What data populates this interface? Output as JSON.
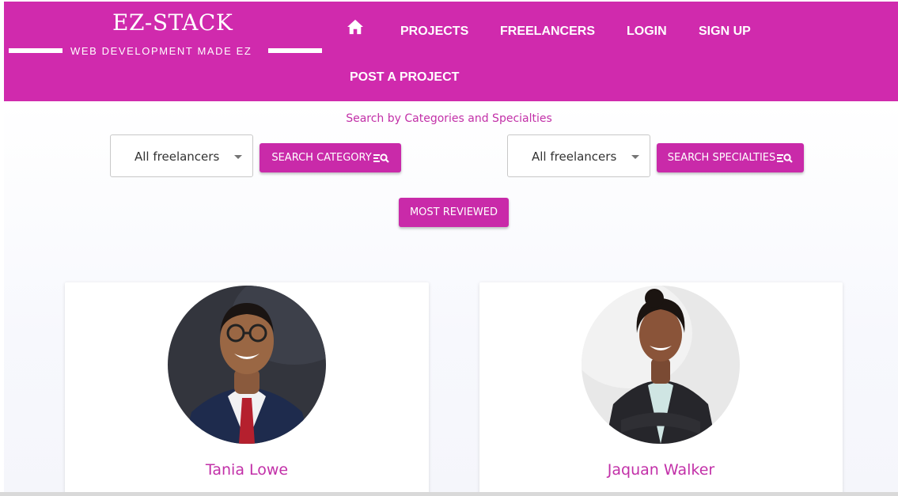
{
  "brand": {
    "title": "EZ-STACK",
    "tagline": "WEB DEVELOPMENT MADE EZ",
    "color": "#d02aad"
  },
  "nav": {
    "home_icon": "home-icon",
    "projects": "PROJECTS",
    "freelancers": "FREELANCERS",
    "login": "LOGIN",
    "signup": "SIGN UP",
    "post_project": "POST A PROJECT"
  },
  "search": {
    "heading": "Search by Categories and Specialties",
    "category_select_value": "All freelancers",
    "category_button": "SEARCH CATEGORY",
    "specialty_select_value": "All freelancers",
    "specialty_button": "SEARCH SPECIALTIES",
    "search_icon": "filter-search-icon",
    "most_reviewed": "MOST REVIEWED"
  },
  "freelancers": [
    {
      "name": "Tania Lowe"
    },
    {
      "name": "Jaquan Walker"
    }
  ]
}
